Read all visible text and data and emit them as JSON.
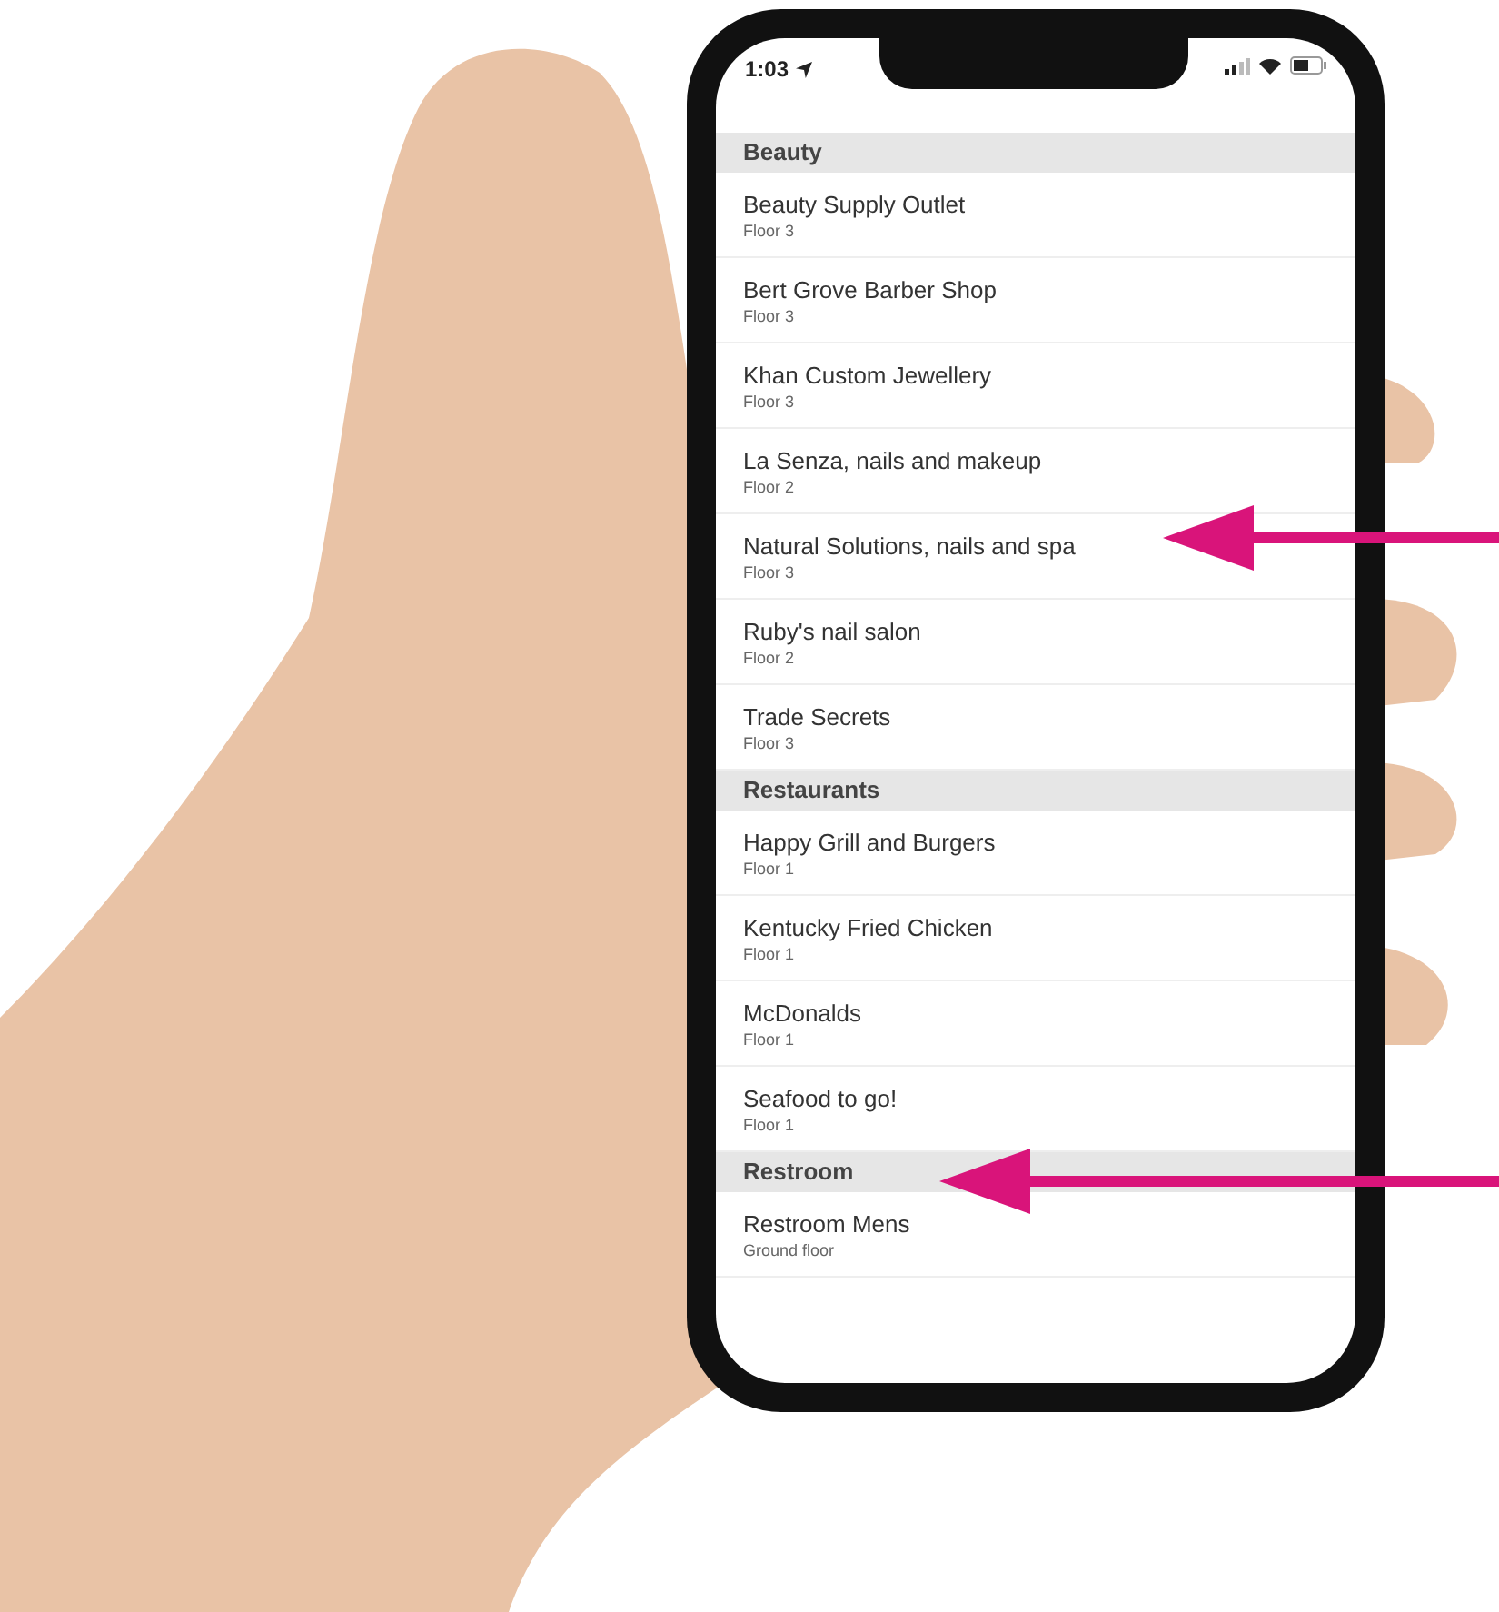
{
  "status_bar": {
    "time": "1:03"
  },
  "sections": [
    {
      "title": "Beauty",
      "items": [
        {
          "name": "Beauty Supply Outlet",
          "location": "Floor 3"
        },
        {
          "name": "Bert Grove Barber Shop",
          "location": "Floor 3"
        },
        {
          "name": "Khan Custom Jewellery",
          "location": "Floor 3"
        },
        {
          "name": "La Senza, nails and makeup",
          "location": "Floor 2"
        },
        {
          "name": "Natural Solutions, nails and spa",
          "location": "Floor 3"
        },
        {
          "name": "Ruby's nail salon",
          "location": "Floor 2"
        },
        {
          "name": "Trade Secrets",
          "location": "Floor 3"
        }
      ]
    },
    {
      "title": "Restaurants",
      "items": [
        {
          "name": "Happy Grill and Burgers",
          "location": "Floor 1"
        },
        {
          "name": "Kentucky Fried Chicken",
          "location": "Floor 1"
        },
        {
          "name": "McDonalds",
          "location": "Floor 1"
        },
        {
          "name": "Seafood to go!",
          "location": "Floor 1"
        }
      ]
    },
    {
      "title": "Restroom",
      "items": [
        {
          "name": "Restroom Mens",
          "location": "Ground floor"
        }
      ]
    }
  ]
}
